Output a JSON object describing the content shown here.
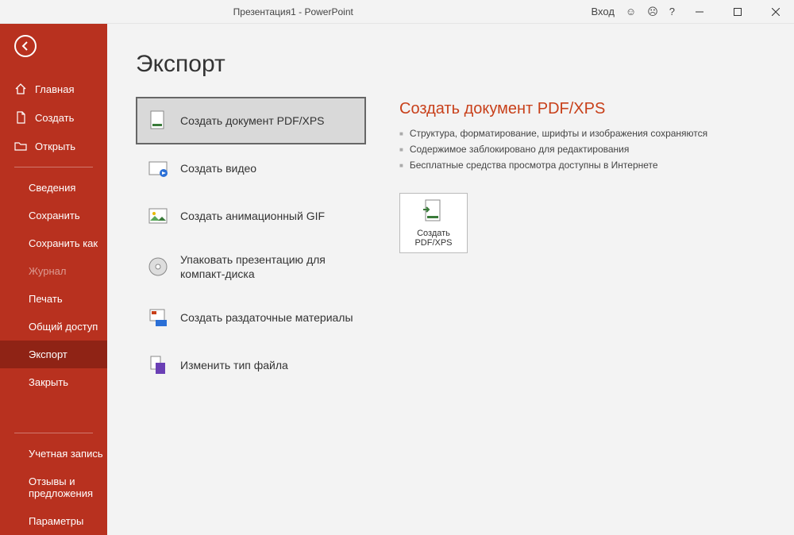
{
  "titlebar": {
    "title": "Презентация1 - PowerPoint",
    "signin": "Вход",
    "help": "?"
  },
  "sidebar": {
    "home": "Главная",
    "create": "Создать",
    "open": "Открыть",
    "info": "Сведения",
    "save": "Сохранить",
    "saveas": "Сохранить как",
    "history": "Журнал",
    "print": "Печать",
    "share": "Общий доступ",
    "export": "Экспорт",
    "close": "Закрыть",
    "account": "Учетная запись",
    "feedback": "Отзывы и предложения",
    "options": "Параметры"
  },
  "page": {
    "title": "Экспорт"
  },
  "options": {
    "pdf": "Создать документ PDF/XPS",
    "video": "Создать видео",
    "gif": "Создать анимационный GIF",
    "cd": "Упаковать презентацию для компакт-диска",
    "handouts": "Создать раздаточные материалы",
    "filetype": "Изменить тип файла"
  },
  "detail": {
    "title": "Создать документ PDF/XPS",
    "b1": "Структура, форматирование, шрифты и изображения сохраняются",
    "b2": "Содержимое заблокировано для редактирования",
    "b3": "Бесплатные средства просмотра доступны в Интернете",
    "button": "Создать PDF/XPS"
  }
}
